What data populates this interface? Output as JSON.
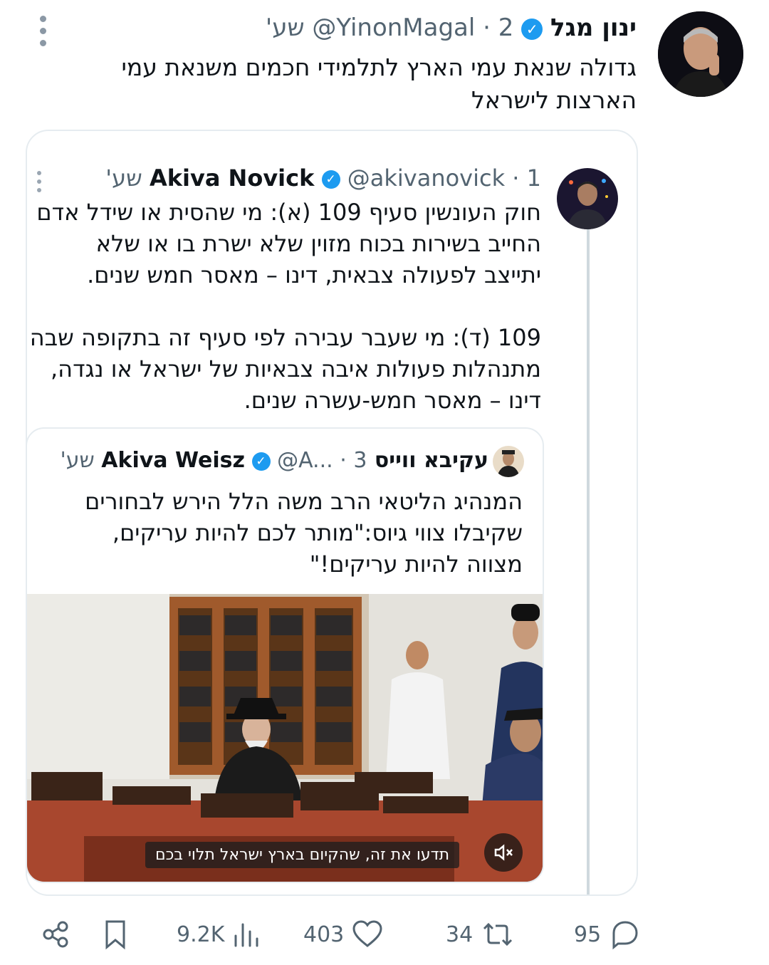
{
  "main_tweet": {
    "author_name": "ינון מגל",
    "handle": "@YinonMagal",
    "time": "2 שע'",
    "text_line1": "גדולה שנאת עמי הארץ לתלמידי חכמים משנאת עמי",
    "text_line2": "הארצות לישראל"
  },
  "quoted_tweet": {
    "author_name": "Akiva Novick",
    "handle": "@akivanovick",
    "time": "1 שע'",
    "paragraph1": [
      "חוק העונשין סעיף 109 (א): מי שהסית או שידל אדם",
      "החייב בשירות בכוח מזוין שלא ישרת בו או שלא",
      "יתייצב לפעולה צבאית, דינו – מאסר חמש שנים."
    ],
    "paragraph2": [
      "109 (ד): מי שעבר עבירה לפי סעיף זה בתקופה שבה",
      "מתנהלות פעולות איבה צבאיות של ישראל או נגדה,",
      "דינו – מאסר חמש-עשרה שנים."
    ]
  },
  "nested_quote": {
    "author_name": "עקיבא ווייס Akiva Weisz",
    "handle": "@A...",
    "time": "3 שע'",
    "text": [
      "המנהיג הליטאי הרב משה הלל הירש לבחורים",
      "שקיבלו צווי גיוס:\"מותר לכם להיות עריקים,",
      "מצווה להיות עריקים!\""
    ],
    "video_subtitle": "תדעו את זה, שהקיום בארץ ישראל תלוי בכם",
    "mute_icon": "speaker-muted-icon"
  },
  "actions": {
    "replies": "95",
    "retweets": "34",
    "likes": "403",
    "views": "9.2K"
  },
  "colors": {
    "verified": "#1d9bf0",
    "muted_text": "#536471",
    "border": "#e6ecf0"
  }
}
